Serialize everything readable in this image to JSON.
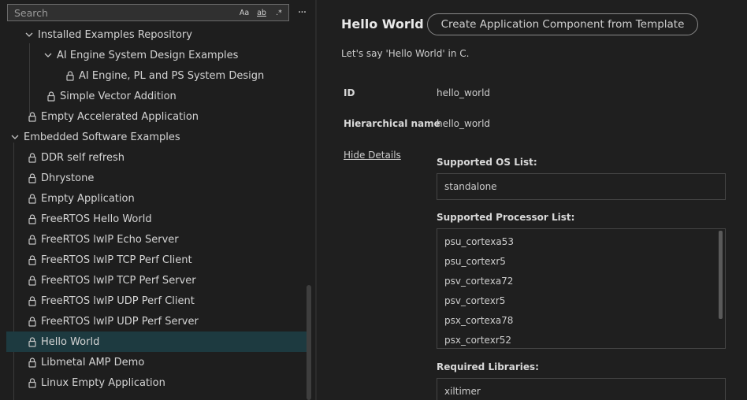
{
  "search": {
    "placeholder": "Search",
    "opt_case": "Aa",
    "opt_word": "ab",
    "opt_regex": ".*"
  },
  "tree": {
    "items": [
      {
        "label": "Installed Examples Repository",
        "type": "folder",
        "selected": false
      },
      {
        "label": "AI Engine System Design Examples",
        "type": "folder",
        "selected": false
      },
      {
        "label": "AI Engine, PL and PS System Design",
        "type": "leaf",
        "selected": false
      },
      {
        "label": "Simple Vector Addition",
        "type": "leaf",
        "selected": false
      },
      {
        "label": "Empty Accelerated Application",
        "type": "leaf",
        "selected": false
      },
      {
        "label": "Embedded Software Examples",
        "type": "folder",
        "selected": false
      },
      {
        "label": "DDR self refresh",
        "type": "leaf",
        "selected": false
      },
      {
        "label": "Dhrystone",
        "type": "leaf",
        "selected": false
      },
      {
        "label": "Empty Application",
        "type": "leaf",
        "selected": false
      },
      {
        "label": "FreeRTOS Hello World",
        "type": "leaf",
        "selected": false
      },
      {
        "label": "FreeRTOS lwIP Echo Server",
        "type": "leaf",
        "selected": false
      },
      {
        "label": "FreeRTOS lwIP TCP Perf Client",
        "type": "leaf",
        "selected": false
      },
      {
        "label": "FreeRTOS lwIP TCP Perf Server",
        "type": "leaf",
        "selected": false
      },
      {
        "label": "FreeRTOS lwIP UDP Perf Client",
        "type": "leaf",
        "selected": false
      },
      {
        "label": "FreeRTOS lwIP UDP Perf Server",
        "type": "leaf",
        "selected": true
      },
      {
        "label": "Hello World",
        "type": "leaf",
        "selected": true
      },
      {
        "label": "Libmetal AMP Demo",
        "type": "leaf",
        "selected": false
      },
      {
        "label": "Linux Empty Application",
        "type": "leaf",
        "selected": false
      }
    ]
  },
  "detail": {
    "title": "Hello World",
    "template_button": "Create Application Component from Template",
    "description": "Let's say 'Hello World' in C.",
    "id_label": "ID",
    "id_value": "hello_world",
    "hier_label": "Hierarchical name",
    "hier_value": "hello_world",
    "hide_details": "Hide Details",
    "os_label": "Supported OS List:",
    "os_list": [
      "standalone"
    ],
    "proc_label": "Supported Processor List:",
    "proc_list": [
      "psu_cortexa53",
      "psu_cortexr5",
      "psv_cortexa72",
      "psv_cortexr5",
      "psx_cortexa78",
      "psx_cortexr52"
    ],
    "lib_label": "Required Libraries:",
    "lib_list": [
      "xiltimer"
    ]
  }
}
